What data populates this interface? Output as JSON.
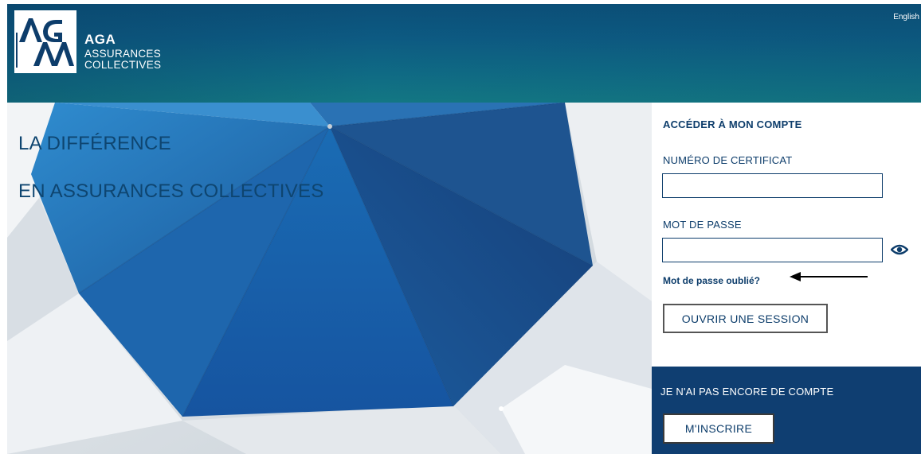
{
  "header": {
    "logo_name": "AGA",
    "logo_line1": "ASSURANCES",
    "logo_line2": "COLLECTIVES",
    "language_link": "English"
  },
  "hero": {
    "line1": "LA DIFFÉRENCE",
    "line2": "EN ASSURANCES COLLECTIVES"
  },
  "login": {
    "title": "ACCÉDER À MON COMPTE",
    "certificate_label": "NUMÉRO DE CERTIFICAT",
    "certificate_value": "",
    "password_label": "MOT DE PASSE",
    "password_value": "",
    "show_password_icon": "eye-icon",
    "forgot_password": "Mot de passe oublié?",
    "submit_label": "OUVRIR UNE SESSION"
  },
  "register": {
    "title": "JE N'AI PAS ENCORE DE COMPTE",
    "button_label": "M'INSCRIRE"
  },
  "colors": {
    "header_blue": "#0b4f78",
    "text_navy": "#0d3d6b",
    "register_bg": "#0f3e71",
    "umbrella_blue": "#1a5fa0"
  }
}
